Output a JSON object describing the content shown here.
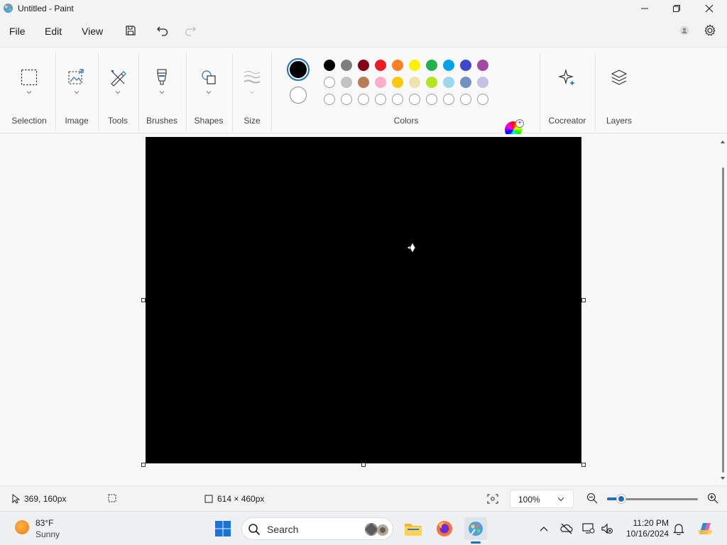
{
  "window": {
    "title": "Untitled - Paint"
  },
  "menu": {
    "file": "File",
    "edit": "Edit",
    "view": "View"
  },
  "ribbon": {
    "groups": [
      {
        "label": "Selection",
        "icon": "selection-icon"
      },
      {
        "label": "Image",
        "icon": "image-icon"
      },
      {
        "label": "Tools",
        "icon": "tools-icon"
      },
      {
        "label": "Brushes",
        "icon": "brush-icon"
      },
      {
        "label": "Shapes",
        "icon": "shapes-icon"
      },
      {
        "label": "Size",
        "icon": "size-icon"
      }
    ],
    "colors_label": "Colors",
    "primary_color": "#000000",
    "secondary_color": "#ffffff",
    "palette_row1": [
      "#000000",
      "#7f7f7f",
      "#880015",
      "#ed1c24",
      "#ff7f27",
      "#fff200",
      "#22b14c",
      "#00a2e8",
      "#3f48cc",
      "#a349a4"
    ],
    "palette_row2": [
      "#ffffff",
      "#c3c3c3",
      "#b97a57",
      "#ffaec9",
      "#ffc90e",
      "#efe4b0",
      "#b5e61d",
      "#99d9ea",
      "#7092be",
      "#c8bfe7"
    ],
    "palette_row3_empty_count": 10,
    "cocreator_label": "Cocreator",
    "layers_label": "Layers"
  },
  "canvas": {
    "fill_color": "#000000"
  },
  "status": {
    "cursor_position": "369, 160px",
    "canvas_size": "614 × 460px",
    "zoom": "100%",
    "zoom_slider_fraction": 0.16
  },
  "taskbar": {
    "weather_temp": "83°F",
    "weather_condition": "Sunny",
    "search_placeholder": "Search",
    "time": "11:20 PM",
    "date": "10/16/2024"
  }
}
